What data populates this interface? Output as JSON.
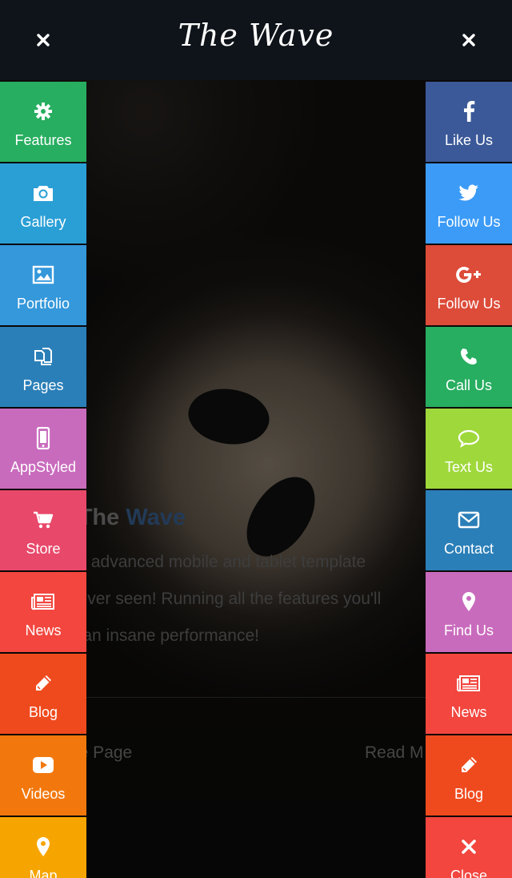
{
  "header": {
    "title": "The Wave",
    "close_left_icon": "close-icon",
    "close_right_icon": "close-icon"
  },
  "hero": {
    "title_prefix": "t The ",
    "title_accent": "Wave",
    "body_line1": "ost advanced mobile and tablet template",
    "body_line2": "e ever seen! Running all the features you'll",
    "body_line3": "at an insane performance!",
    "footer_left": "are Page",
    "footer_right": "Read M"
  },
  "left_menu": {
    "items": [
      {
        "label": "Features",
        "icon": "gear-icon",
        "color": "#27ae60"
      },
      {
        "label": "Gallery",
        "icon": "camera-icon",
        "color": "#2a9fd6"
      },
      {
        "label": "Portfolio",
        "icon": "image-icon",
        "color": "#3498db"
      },
      {
        "label": "Pages",
        "icon": "pages-icon",
        "color": "#2b7fb8"
      },
      {
        "label": "AppStyled",
        "icon": "phone-icon",
        "color": "#c96bbd"
      },
      {
        "label": "Store",
        "icon": "cart-icon",
        "color": "#e8486a"
      },
      {
        "label": "News",
        "icon": "newspaper-icon",
        "color": "#f2463e"
      },
      {
        "label": "Blog",
        "icon": "pencil-icon",
        "color": "#ef4a1e"
      },
      {
        "label": "Videos",
        "icon": "play-icon",
        "color": "#f2780d"
      },
      {
        "label": "Map",
        "icon": "map-pin-icon",
        "color": "#f6a500"
      }
    ]
  },
  "right_menu": {
    "items": [
      {
        "label": "Like Us",
        "icon": "facebook-icon",
        "color": "#3b5998"
      },
      {
        "label": "Follow Us",
        "icon": "twitter-icon",
        "color": "#3b9bf7"
      },
      {
        "label": "Follow Us",
        "icon": "google-plus-icon",
        "color": "#dd4b39"
      },
      {
        "label": "Call Us",
        "icon": "phone-call-icon",
        "color": "#27ae60"
      },
      {
        "label": "Text Us",
        "icon": "chat-icon",
        "color": "#9fd83b"
      },
      {
        "label": "Contact",
        "icon": "envelope-icon",
        "color": "#2b7fb8"
      },
      {
        "label": "Find Us",
        "icon": "map-pin-icon",
        "color": "#c96bbd"
      },
      {
        "label": "News",
        "icon": "newspaper-icon",
        "color": "#f2463e"
      },
      {
        "label": "Blog",
        "icon": "pencil-icon",
        "color": "#ef4a1e"
      },
      {
        "label": "Close",
        "icon": "close-icon",
        "color": "#f2463e"
      }
    ]
  }
}
